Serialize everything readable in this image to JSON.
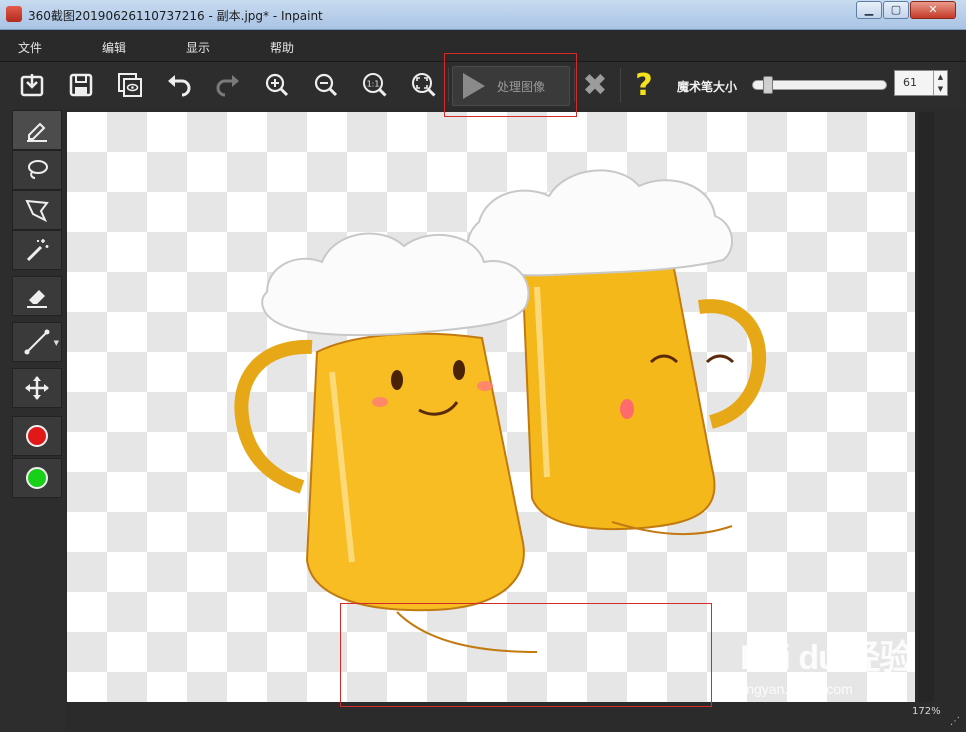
{
  "window": {
    "title": "360截图20190626110737216 - 副本.jpg* - Inpaint",
    "min_symbol": "▁",
    "max_symbol": "▢",
    "close_symbol": "✕"
  },
  "menu": {
    "items": [
      "文件",
      "编辑",
      "显示",
      "帮助"
    ]
  },
  "toolbar": {
    "buttons": [
      "open-icon",
      "save-icon",
      "preview-icon",
      "undo-icon",
      "redo-icon",
      "zoom-in-icon",
      "zoom-out-icon",
      "actual-size-icon",
      "fit-icon"
    ],
    "process_label": "处理图像",
    "clear_symbol": "✖",
    "help_symbol": "?",
    "brush_size_label": "魔术笔大小",
    "brush_size_value": "61",
    "brush_size_fraction": 0.08
  },
  "tools": {
    "items": [
      "marker-icon",
      "lasso-icon",
      "polygonal-lasso-icon",
      "magic-wand-icon",
      "eraser-icon",
      "line-icon",
      "move-icon"
    ],
    "color_red": "#e01818",
    "color_green": "#18d018"
  },
  "status": {
    "zoom": "172%"
  },
  "watermark": {
    "main": "Bai du 经验",
    "sub": "jingyan.baidu.com"
  }
}
